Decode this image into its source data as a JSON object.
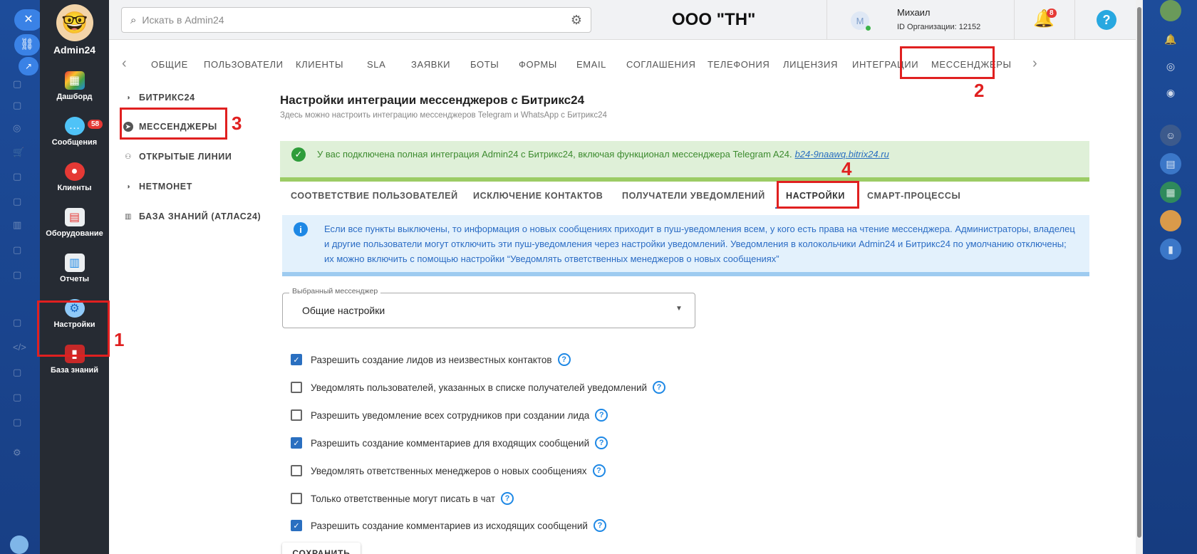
{
  "topbar": {
    "search_placeholder": "Искать в Admin24",
    "company": "ООО \"ТН\"",
    "user_initial": "М",
    "user_name": "Михаил",
    "org_id": "ID Организации: 12152",
    "notifications_count": "8",
    "help": "?"
  },
  "rail": {
    "brand": "Admin24",
    "items": [
      {
        "label": "Дашборд"
      },
      {
        "label": "Сообщения",
        "badge": "58"
      },
      {
        "label": "Клиенты"
      },
      {
        "label": "Оборудование"
      },
      {
        "label": "Отчеты"
      },
      {
        "label": "Настройки"
      },
      {
        "label": "База знаний"
      }
    ]
  },
  "tabs": [
    "ОБЩИЕ",
    "ПОЛЬЗОВАТЕЛИ",
    "КЛИЕНТЫ",
    "SLA",
    "ЗАЯВКИ",
    "БОТЫ",
    "ФОРМЫ",
    "EMAIL",
    "СОГЛАШЕНИЯ",
    "ТЕЛЕФОНИЯ",
    "ЛИЦЕНЗИЯ",
    "ИНТЕГРАЦИИ",
    "МЕССЕНДЖЕРЫ"
  ],
  "subnav": [
    "БИТРИКС24",
    "МЕССЕНДЖЕРЫ",
    "ОТКРЫТЫЕ ЛИНИИ",
    "НЕТМОНЕТ",
    "БАЗА ЗНАНИЙ (АТЛАС24)"
  ],
  "page": {
    "title": "Настройки интеграции мессенджеров с Битрикс24",
    "subtitle": "Здесь можно настроить интеграцию мессенджеров Telegram и WhatsApp с Битрикс24",
    "success_text": "У вас подключена полная интеграция Admin24 с Битрикс24, включая функционал мессенджера Telegram A24.",
    "success_link": "b24-9naawq.bitrix24.ru",
    "subtabs": [
      "СООТВЕТСТВИЕ ПОЛЬЗОВАТЕЛЕЙ",
      "ИСКЛЮЧЕНИЕ КОНТАКТОВ",
      "ПОЛУЧАТЕЛИ УВЕДОМЛЕНИЙ",
      "НАСТРОЙКИ",
      "СМАРТ-ПРОЦЕССЫ"
    ],
    "info_text": "Если все пункты выключены, то информация о новых сообщениях приходит в пуш-уведомления всем, у кого есть права на чтение мессенджера. Администраторы, владелец и другие пользователи могут отключить эти пуш-уведомления через настройки уведомлений. Уведомления в колокольчики Admin24 и Битрикс24 по умолчанию отключены; их можно включить с помощью настройки “Уведомлять ответственных менеджеров о новых сообщениях”",
    "select_label": "Выбранный мессенджер",
    "select_value": "Общие настройки",
    "options": [
      {
        "label": "Разрешить создание лидов из неизвестных контактов",
        "checked": true
      },
      {
        "label": "Уведомлять пользователей, указанных в списке получателей уведомлений",
        "checked": false
      },
      {
        "label": "Разрешить уведомление всех сотрудников при создании лида",
        "checked": false
      },
      {
        "label": "Разрешить создание комментариев для входящих сообщений",
        "checked": true
      },
      {
        "label": "Уведомлять ответственных менеджеров о новых сообщениях",
        "checked": false
      },
      {
        "label": "Только ответственные могут писать в чат",
        "checked": false
      },
      {
        "label": "Разрешить создание комментариев из исходящих сообщений",
        "checked": true
      }
    ],
    "save_label": "СОХРАНИТЬ"
  },
  "annotations": [
    "1",
    "2",
    "3",
    "4"
  ],
  "colors": {
    "accent": "#2a6fc0",
    "annotation": "#e02020",
    "success": "#3d8b2f",
    "info": "#2b6cc4"
  }
}
